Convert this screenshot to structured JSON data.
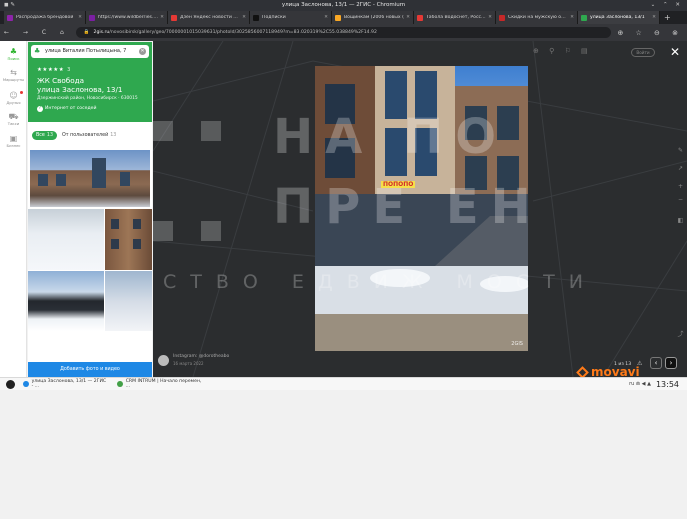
{
  "browser": {
    "window_title": "улица Заслонова, 13/1 — 2ГИС - Chromium",
    "tabs": [
      {
        "label": "Распродажа брендовой",
        "color": "#8e24aa",
        "active": false
      },
      {
        "label": "https://www.wildberries.ru",
        "color": "#7b1fa2",
        "active": false
      },
      {
        "label": "Дзен Яндекс новости — Я",
        "color": "#e53935",
        "active": false
      },
      {
        "label": "Подписки",
        "color": "#111111",
        "active": false
      },
      {
        "label": "Вощинкам (2006 новых (",
        "color": "#f9a825",
        "active": false
      },
      {
        "label": "Табола Водоснёт, Россия",
        "color": "#e53935",
        "active": false
      },
      {
        "label": "Скидки на мужскую одеж",
        "color": "#c62828",
        "active": false
      },
      {
        "label": "улица Заслонова, 13/1",
        "color": "#2fa84f",
        "active": true
      }
    ],
    "new_tab_symbol": "+",
    "nav_symbols": "← → C ⌂",
    "url_host": "2gis.ru",
    "url_rest": "/novosibirsk/gallery/geo/70000001015039631/photoId/3025856007118949?m=83.020319%2C55.038849%2F14.92",
    "lock_symbol": "🔒",
    "toolbar_right": "⊕ ☆ ⊖ ⊗"
  },
  "rail": {
    "items": [
      {
        "label": "Поиск",
        "icon": "tree-pin-icon",
        "glyph": "♣",
        "active": true
      },
      {
        "label": "Маршруты",
        "icon": "route-icon",
        "glyph": "⇆",
        "active": false
      },
      {
        "label": "Друзья",
        "icon": "friends-icon",
        "glyph": "☺",
        "active": false
      },
      {
        "label": "Такси",
        "icon": "taxi-icon",
        "glyph": "⛟",
        "active": false
      },
      {
        "label": "Бизнес",
        "icon": "bag-icon",
        "glyph": "▣",
        "active": false
      }
    ]
  },
  "card": {
    "search_value": "улица Виталия Потылицына, 7",
    "stars": "★★★★★",
    "rating_count": "3",
    "title_line1": "ЖК Свобода",
    "title_line2": "улица Заслонова, 13/1",
    "address_line": "Дзержинский район, Новосибирск · 630015",
    "internet_label": "Интернет от сосeдей",
    "accent_color": "#2fa84f"
  },
  "filters": {
    "all_label": "Все",
    "all_count": "13",
    "user_label": "От пользователей",
    "user_count": "13"
  },
  "add_photo_label": "Добавить фото и видео",
  "viewer": {
    "watermark_line1": "НА ПО",
    "watermark_line2": "ПРЕ ЕН",
    "watermark_line3": "СТВО ЕДВИЖ МОСТИ",
    "photo_label": "2GIS",
    "photo_sign": "ПОПОПО",
    "top_tools": "⊕ ⚲ ⚐ ▤",
    "top_pill": "Войти",
    "close_symbol": "✕",
    "attribution_line1": "Instagram: @dorotheabo",
    "attribution_line2": "16 марта 2022",
    "counter": "1 из 13",
    "warn_symbol": "⚠",
    "prev_symbol": "‹",
    "next_symbol": "›",
    "movavi_label": "movavi"
  },
  "taskbar": {
    "windows": [
      {
        "label": "улица Заслонова, 13/1 — 2ГИС - ...",
        "color": "#1e88e5"
      },
      {
        "label": "CRM INTRUM | Начало перемен, ...",
        "color": "#43a047"
      }
    ],
    "tray_text": "ru ⋒ ◀ ▲",
    "clock": "13:54"
  }
}
